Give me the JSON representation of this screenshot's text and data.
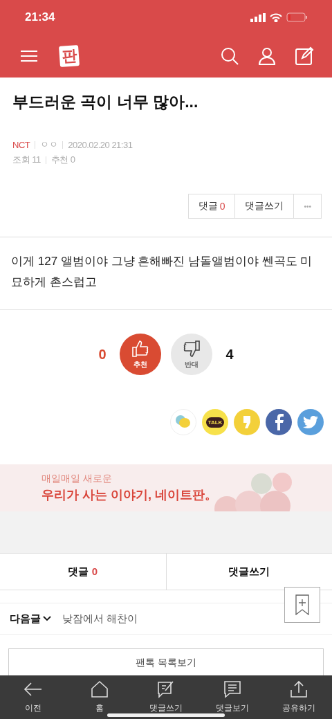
{
  "status_bar": {
    "time": "21:34"
  },
  "nav": {
    "logo": "판"
  },
  "post": {
    "title": "부드러운 곡이 너무 많아...",
    "category": "NCT",
    "author": "ㅇㅇ",
    "date": "2020.02.20 21:31",
    "views_label": "조회",
    "views": "11",
    "recommend_label": "추천",
    "recommend": "0"
  },
  "post_actions": {
    "comments_label": "댓글",
    "comments_count": "0",
    "write_comment": "댓글쓰기",
    "more": "•••"
  },
  "body": "이게 127 앨범이야 그냥 흔해빠진 남돌앨범이야 쎈곡도 미묘하게 촌스럽고",
  "votes": {
    "up_count": "0",
    "up_label": "추천",
    "down_label": "반대",
    "down_count": "4",
    "up_selected": true
  },
  "share": [
    {
      "kind": "chat"
    },
    {
      "kind": "talk",
      "label": "TALK"
    },
    {
      "kind": "story"
    },
    {
      "kind": "facebook"
    },
    {
      "kind": "twitter"
    }
  ],
  "banner": {
    "line_1": "매일매일 새로운",
    "line_2": "우리가 사는 이야기, 네이트판。"
  },
  "comment_bar": {
    "comments_label": "댓글",
    "comments_count": "0",
    "write_comment": "댓글쓰기"
  },
  "next_post": {
    "label": "다음글",
    "title": "낮잠에서 해찬이"
  },
  "list_button": "팬톡 목록보기",
  "tab_bar": [
    {
      "kind": "back",
      "label": "이전"
    },
    {
      "kind": "home",
      "label": "홈"
    },
    {
      "kind": "write",
      "label": "댓글쓰기"
    },
    {
      "kind": "view",
      "label": "댓글보기"
    },
    {
      "kind": "share",
      "label": "공유하기"
    }
  ]
}
